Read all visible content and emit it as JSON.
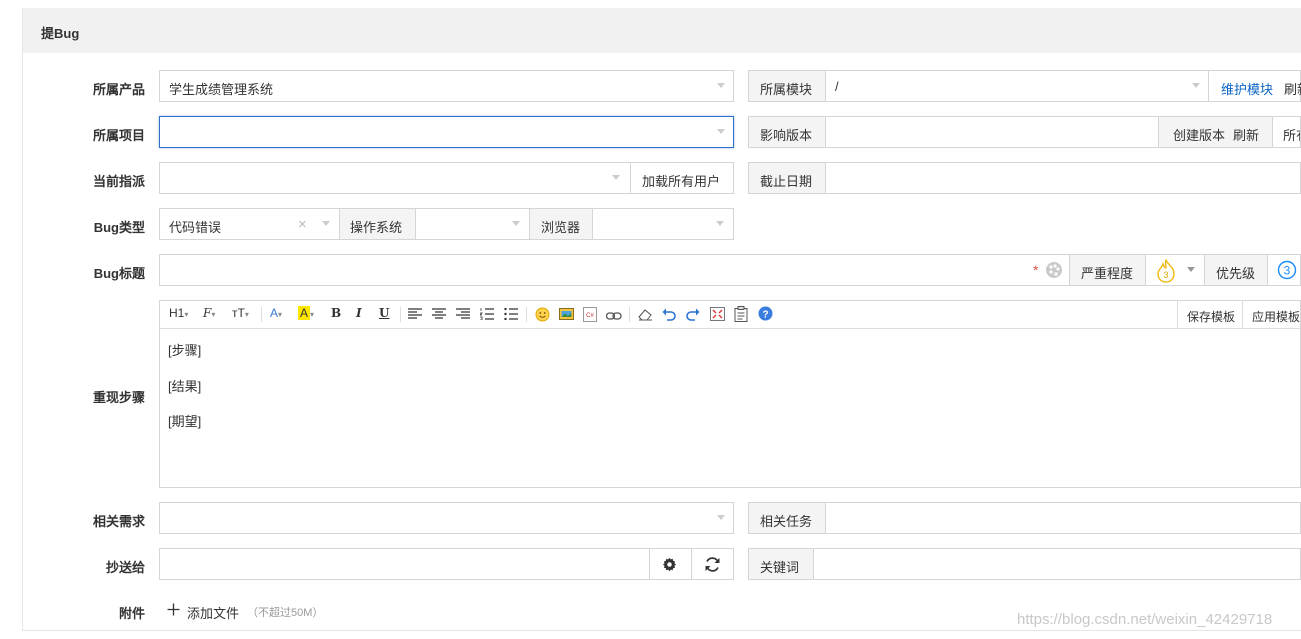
{
  "panel": {
    "title": "提Bug"
  },
  "fields": {
    "product": {
      "label": "所属产品",
      "value": "学生成绩管理系统"
    },
    "module": {
      "label": "所属模块",
      "value": "/",
      "maintain": "维护模块",
      "refresh": "刷新"
    },
    "project": {
      "label": "所属项目",
      "value": ""
    },
    "build": {
      "label": "影响版本",
      "create": "创建版本",
      "refresh": "刷新",
      "all": "所有"
    },
    "assign": {
      "label": "当前指派",
      "load_all": "加载所有用户"
    },
    "deadline": {
      "label": "截止日期"
    },
    "type": {
      "label": "Bug类型",
      "value": "代码错误",
      "clear": "×"
    },
    "os": {
      "label": "操作系统"
    },
    "browser": {
      "label": "浏览器"
    },
    "title": {
      "label": "Bug标题",
      "required": "*"
    },
    "severity": {
      "label": "严重程度",
      "value": "3"
    },
    "priority": {
      "label": "优先级",
      "value": "3"
    },
    "steps": {
      "label": "重现步骤",
      "lines": [
        "[步骤]",
        "[结果]",
        "[期望]"
      ],
      "save_template": "保存模板",
      "apply_template": "应用模板"
    },
    "story": {
      "label": "相关需求"
    },
    "task": {
      "label": "相关任务"
    },
    "mailto": {
      "label": "抄送给"
    },
    "keywords": {
      "label": "关键词"
    },
    "files": {
      "label": "附件",
      "add": "添加文件",
      "limit": "（不超过50M）"
    }
  },
  "toolbar": {
    "heading": "H1",
    "font_family": "F",
    "font_size": "тT",
    "font_color": "A",
    "bg_color": "A",
    "bold": "B",
    "italic": "I",
    "underline": "U"
  },
  "watermark": "https://blog.csdn.net/weixin_42429718",
  "colors": {
    "accent": "#0c64c5",
    "focus": "#2f6ec9",
    "required": "#d9534f",
    "highlight": "#ffe600"
  }
}
